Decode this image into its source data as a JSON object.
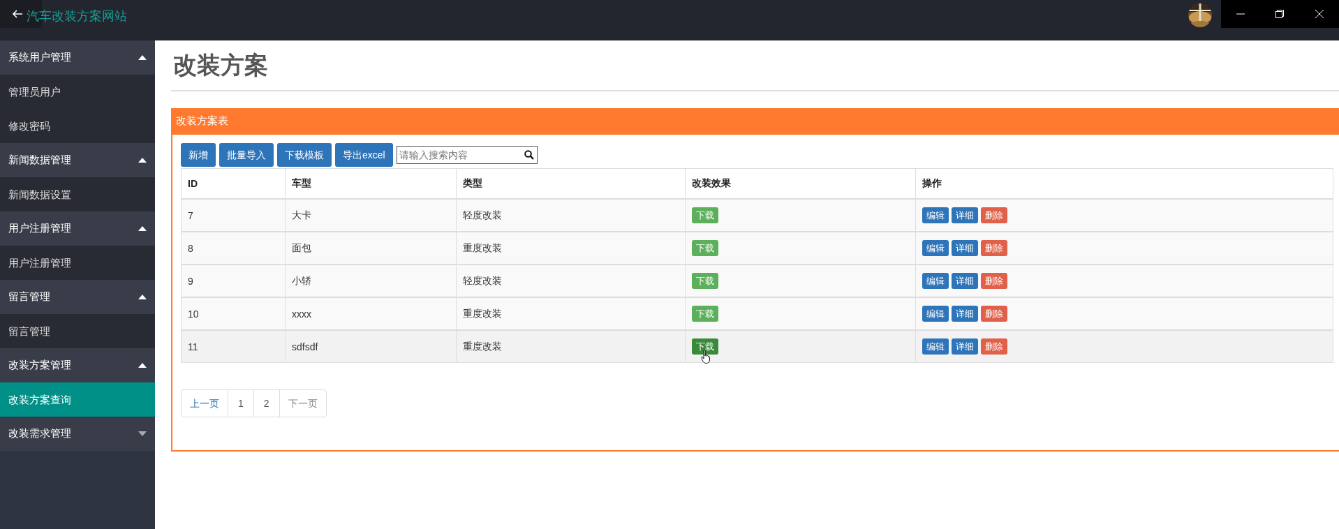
{
  "header": {
    "title": "汽车改装方案网站"
  },
  "sidebar": {
    "groups": [
      {
        "label": "系统用户管理",
        "expanded": true,
        "items": [
          {
            "label": "管理员用户",
            "selected": false
          },
          {
            "label": "修改密码",
            "selected": false
          }
        ]
      },
      {
        "label": "新闻数据管理",
        "expanded": true,
        "items": [
          {
            "label": "新闻数据设置",
            "selected": false
          }
        ]
      },
      {
        "label": "用户注册管理",
        "expanded": true,
        "items": [
          {
            "label": "用户注册管理",
            "selected": false
          }
        ]
      },
      {
        "label": "留言管理",
        "expanded": true,
        "items": [
          {
            "label": "留言管理",
            "selected": false
          }
        ]
      },
      {
        "label": "改装方案管理",
        "expanded": true,
        "items": [
          {
            "label": "改装方案查询",
            "selected": true
          }
        ]
      },
      {
        "label": "改装需求管理",
        "expanded": false
      }
    ]
  },
  "page_title": "改装方案",
  "panel": {
    "title": "改装方案表",
    "toolbar": {
      "buttons": [
        "新增",
        "批量导入",
        "下载模板",
        "导出excel"
      ],
      "search": {
        "placeholder": "请输入搜索内容"
      }
    },
    "table": {
      "columns": [
        "ID",
        "车型",
        "类型",
        "改装效果",
        "操作"
      ],
      "rows": [
        {
          "id": "7",
          "model": "大卡",
          "type": "轻度改装",
          "effect": "下载",
          "actions": [
            "编辑",
            "详细",
            "删除"
          ],
          "hovered": false
        },
        {
          "id": "8",
          "model": "面包",
          "type": "重度改装",
          "effect": "下载",
          "actions": [
            "编辑",
            "详细",
            "删除"
          ],
          "hovered": false
        },
        {
          "id": "9",
          "model": "小轿",
          "type": "轻度改装",
          "effect": "下载",
          "actions": [
            "编辑",
            "详细",
            "删除"
          ],
          "hovered": false
        },
        {
          "id": "10",
          "model": "xxxx",
          "type": "重度改装",
          "effect": "下载",
          "actions": [
            "编辑",
            "详细",
            "删除"
          ],
          "hovered": false
        },
        {
          "id": "11",
          "model": "sdfsdf",
          "type": "重度改装",
          "effect": "下载",
          "actions": [
            "编辑",
            "详细",
            "删除"
          ],
          "hovered": true
        }
      ]
    },
    "pagination": [
      {
        "label": "上一页",
        "kind": "prev",
        "disabled": false
      },
      {
        "label": "1",
        "kind": "page",
        "disabled": false
      },
      {
        "label": "2",
        "kind": "page",
        "disabled": false
      },
      {
        "label": "下一页",
        "kind": "next",
        "disabled": true
      }
    ]
  }
}
